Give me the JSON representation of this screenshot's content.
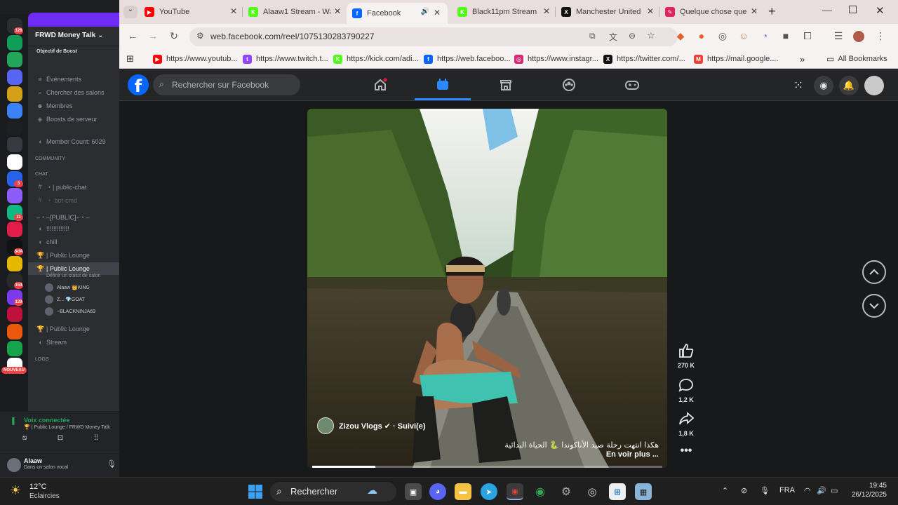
{
  "discord": {
    "server_name": "FRWD Money Talk",
    "boost_goal": "Objectif de Boost",
    "server_badges": [
      "126",
      "",
      "",
      "",
      "",
      "",
      "",
      "",
      "",
      "3",
      "",
      "11",
      "",
      "SdA",
      "",
      "154",
      "129",
      "",
      "",
      "",
      "NOUVEAU"
    ],
    "menu": [
      {
        "icon": "≡",
        "label": "Événements"
      },
      {
        "icon": "⌕",
        "label": "Chercher des salons"
      },
      {
        "icon": "☻",
        "label": "Membres"
      },
      {
        "icon": "◈",
        "label": "Boosts de serveur"
      }
    ],
    "member_count": "Member Count: 6029",
    "categories": {
      "community": "COMMUNITY",
      "chat": "CHAT"
    },
    "channels": [
      {
        "icon": "#",
        "label": "・| public-chat"
      },
      {
        "icon": "#",
        "label": "・ bot-cmd"
      },
      {
        "icon": "",
        "label": "–・–[PUBLIC]–・–"
      },
      {
        "icon": "◖",
        "label": "!!!!!!!!!!!!!"
      },
      {
        "icon": "◖",
        "label": "chill"
      },
      {
        "icon": "🏆",
        "label": "| Public Lounge"
      },
      {
        "icon": "🏆",
        "label": "| Public Lounge"
      }
    ],
    "active_channel_status": "Définir un statut de salon",
    "voice_users": [
      "Alaaw 👑KING",
      "Z... 💎GOAT",
      "~BLACKNINJA69"
    ],
    "channels_after": [
      {
        "icon": "🏆",
        "label": "| Public Lounge"
      },
      {
        "icon": "◖",
        "label": "Stream"
      }
    ],
    "logs": "LOGS",
    "voice_status": "Voix connectée",
    "voice_location": "🏆 | Public Lounge / FRWD Money Talk",
    "user_name": "Alaaw",
    "user_status": "Dans un salon vocal"
  },
  "browser": {
    "tabs": [
      {
        "title": "YouTube",
        "color": "#ff0000",
        "glyph": "▶"
      },
      {
        "title": "Alaaw1 Stream - Wa",
        "color": "#53fc18",
        "glyph": "K"
      },
      {
        "title": "Facebook",
        "color": "#0866ff",
        "glyph": "f"
      },
      {
        "title": "Black11pm Stream",
        "color": "#53fc18",
        "glyph": "K"
      },
      {
        "title": "Manchester United",
        "color": "#111111",
        "glyph": "X"
      },
      {
        "title": "Quelque chose que",
        "color": "#e0245e",
        "glyph": "✎"
      }
    ],
    "url": "web.facebook.com/reel/1075130283790227",
    "bookmarks": [
      {
        "label": "https://www.youtub...",
        "color": "#ff0000",
        "glyph": "▶"
      },
      {
        "label": "https://www.twitch.t...",
        "color": "#9146ff",
        "glyph": "t"
      },
      {
        "label": "https://kick.com/adi...",
        "color": "#53fc18",
        "glyph": "K"
      },
      {
        "label": "https://web.faceboo...",
        "color": "#0866ff",
        "glyph": "f"
      },
      {
        "label": "https://www.instagr...",
        "color": "#d62976",
        "glyph": "◎"
      },
      {
        "label": "https://twitter.com/...",
        "color": "#111111",
        "glyph": "X"
      },
      {
        "label": "https://mail.google....",
        "color": "#ea4335",
        "glyph": "M"
      }
    ],
    "all_bookmarks": "All Bookmarks"
  },
  "facebook": {
    "search_placeholder": "Rechercher sur Facebook",
    "reel": {
      "author": "Zizou Vlogs ✔ · Suivi(e)",
      "caption": "هكذا انتهت رحلة صيد الأناكوندا 🐍 الحياة البدائية",
      "see_more": "En voir plus ...",
      "progress": 0.18
    },
    "actions": {
      "likes": "270 K",
      "comments": "1,2 K",
      "shares": "1,8 K"
    }
  },
  "taskbar": {
    "temperature": "12°C",
    "weather": "Eclaircies",
    "search": "Rechercher",
    "language": "FRA",
    "time": "19:45",
    "date": "26/12/2025"
  }
}
